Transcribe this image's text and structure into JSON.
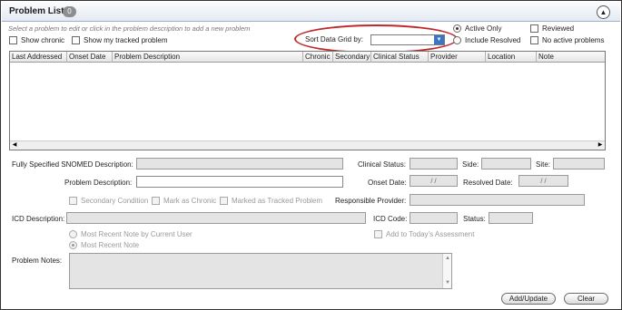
{
  "header": {
    "title": "Problem List",
    "count": "0",
    "collapse_icon": "chevron-up-icon"
  },
  "hint": "Select a problem to edit or click in the problem description to add a new problem",
  "filters": {
    "show_chronic": "Show chronic",
    "show_tracked": "Show my tracked problem",
    "active_only": "Active Only",
    "include_resolved": "Include Resolved",
    "reviewed": "Reviewed",
    "no_active_problems": "No active problems"
  },
  "sort": {
    "label": "Sort Data Grid by:",
    "value": ""
  },
  "grid": {
    "columns": [
      "Last Addressed",
      "Onset Date",
      "Problem Description",
      "Chronic",
      "Secondary",
      "Clinical Status",
      "Provider",
      "Location",
      "Note"
    ],
    "rows": []
  },
  "form": {
    "snomed_label": "Fully Specified SNOMED Description:",
    "clinical_status_label": "Clinical Status:",
    "side_label": "Side:",
    "site_label": "Site:",
    "problem_desc_label": "Problem Description:",
    "onset_date_label": "Onset Date:",
    "onset_date_value": "/ /",
    "resolved_date_label": "Resolved Date:",
    "resolved_date_value": "/ /",
    "secondary_condition": "Secondary Condition",
    "mark_chronic": "Mark as Chronic",
    "mark_tracked": "Marked as Tracked Problem",
    "responsible_provider_label": "Responsible Provider:",
    "icd_desc_label": "ICD Description:",
    "icd_code_label": "ICD Code:",
    "status_label": "Status:",
    "most_recent_by_user": "Most Recent Note by Current User",
    "most_recent_note": "Most Recent Note",
    "add_to_assessment": "Add to Today's Assessment",
    "problem_notes_label": "Problem Notes:"
  },
  "buttons": {
    "add_update": "Add/Update",
    "clear": "Clear"
  }
}
